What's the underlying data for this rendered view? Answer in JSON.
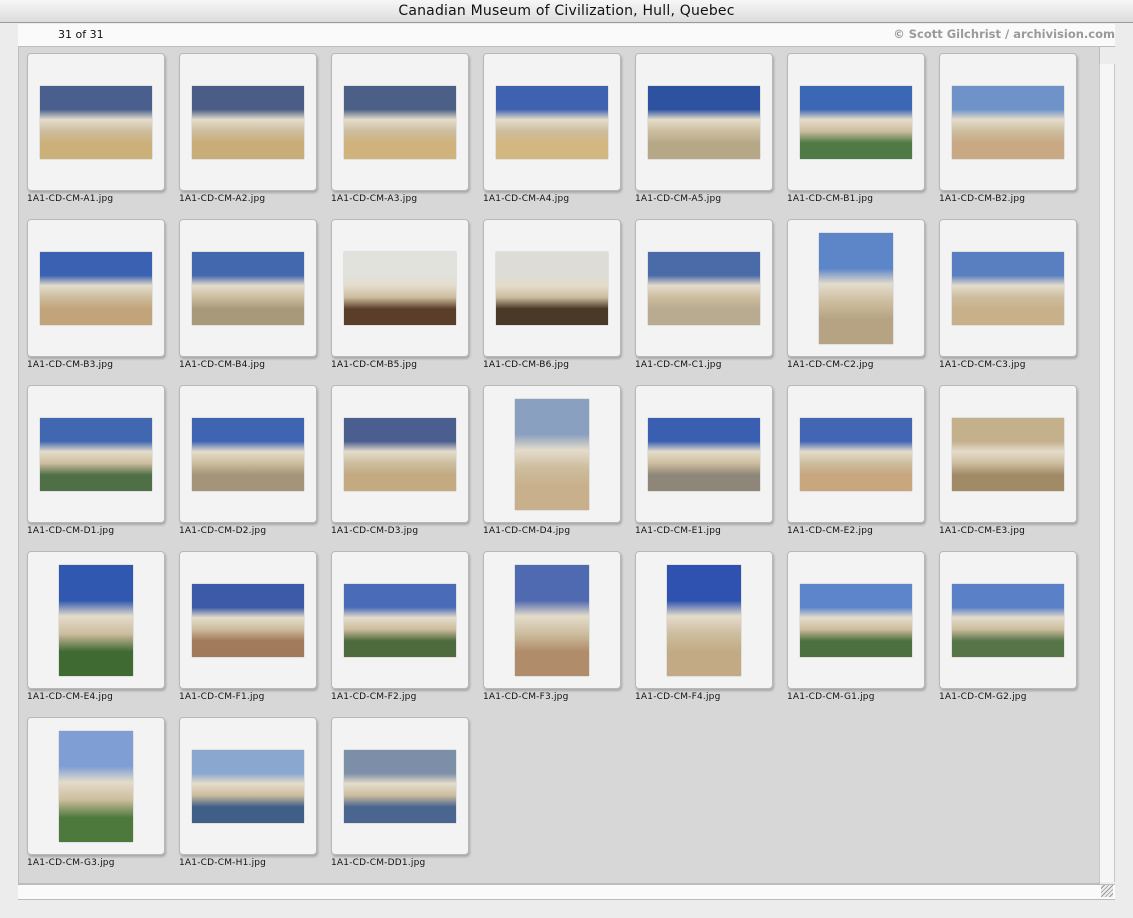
{
  "window": {
    "title": "Canadian Museum of Civilization, Hull, Quebec"
  },
  "info": {
    "count": "31 of 31",
    "credit": "© Scott Gilchrist / archivision.com"
  },
  "icons": {
    "resize": "resize-grip-icon"
  },
  "thumbnails": [
    {
      "name": "1A1-CD-CM-A1.jpg",
      "orientation": "landscape",
      "sky": "#4a5f8e",
      "ground": "#cbb07a"
    },
    {
      "name": "1A1-CD-CM-A2.jpg",
      "orientation": "landscape",
      "sky": "#4b5c86",
      "ground": "#c9ad78"
    },
    {
      "name": "1A1-CD-CM-A3.jpg",
      "orientation": "landscape",
      "sky": "#4c5f86",
      "ground": "#cfb27c"
    },
    {
      "name": "1A1-CD-CM-A4.jpg",
      "orientation": "landscape",
      "sky": "#3f62b0",
      "ground": "#d2b781"
    },
    {
      "name": "1A1-CD-CM-A5.jpg",
      "orientation": "landscape",
      "sky": "#2c52a0",
      "ground": "#b6a887"
    },
    {
      "name": "1A1-CD-CM-B1.jpg",
      "orientation": "landscape",
      "sky": "#3c67b4",
      "ground": "#4f7a45"
    },
    {
      "name": "1A1-CD-CM-B2.jpg",
      "orientation": "landscape",
      "sky": "#6f93c8",
      "ground": "#c8a983"
    },
    {
      "name": "1A1-CD-CM-B3.jpg",
      "orientation": "landscape",
      "sky": "#3a61b2",
      "ground": "#c2a47a"
    },
    {
      "name": "1A1-CD-CM-B4.jpg",
      "orientation": "landscape",
      "sky": "#4468ad",
      "ground": "#a8997a"
    },
    {
      "name": "1A1-CD-CM-B5.jpg",
      "orientation": "landscape",
      "sky": "#e2e2dc",
      "ground": "#5a3e2a"
    },
    {
      "name": "1A1-CD-CM-B6.jpg",
      "orientation": "landscape",
      "sky": "#dedcd6",
      "ground": "#4a3828"
    },
    {
      "name": "1A1-CD-CM-C1.jpg",
      "orientation": "landscape",
      "sky": "#4b6aa8",
      "ground": "#b9ab8f"
    },
    {
      "name": "1A1-CD-CM-C2.jpg",
      "orientation": "portrait",
      "sky": "#5c86c8",
      "ground": "#b5a383"
    },
    {
      "name": "1A1-CD-CM-C3.jpg",
      "orientation": "landscape",
      "sky": "#5a7fc0",
      "ground": "#c7b08a"
    },
    {
      "name": "1A1-CD-CM-D1.jpg",
      "orientation": "landscape",
      "sky": "#4067b0",
      "ground": "#4f7046"
    },
    {
      "name": "1A1-CD-CM-D2.jpg",
      "orientation": "landscape",
      "sky": "#3f65b2",
      "ground": "#a3947a"
    },
    {
      "name": "1A1-CD-CM-D3.jpg",
      "orientation": "landscape",
      "sky": "#4a5e8f",
      "ground": "#c4aa80"
    },
    {
      "name": "1A1-CD-CM-D4.jpg",
      "orientation": "portrait",
      "sky": "#8aa0c0",
      "ground": "#c8b08c"
    },
    {
      "name": "1A1-CD-CM-E1.jpg",
      "orientation": "landscape",
      "sky": "#3a5fb0",
      "ground": "#8e8678"
    },
    {
      "name": "1A1-CD-CM-E2.jpg",
      "orientation": "landscape",
      "sky": "#4265b4",
      "ground": "#c8a67e"
    },
    {
      "name": "1A1-CD-CM-E3.jpg",
      "orientation": "landscape",
      "sky": "#c5b08c",
      "ground": "#a18a66"
    },
    {
      "name": "1A1-CD-CM-E4.jpg",
      "orientation": "portrait",
      "sky": "#3158b0",
      "ground": "#3f6a32"
    },
    {
      "name": "1A1-CD-CM-F1.jpg",
      "orientation": "landscape",
      "sky": "#3c5aa8",
      "ground": "#a07a5a"
    },
    {
      "name": "1A1-CD-CM-F2.jpg",
      "orientation": "landscape",
      "sky": "#4a6cb8",
      "ground": "#4d6b3c"
    },
    {
      "name": "1A1-CD-CM-F3.jpg",
      "orientation": "portrait",
      "sky": "#4f6ab0",
      "ground": "#b08c6a"
    },
    {
      "name": "1A1-CD-CM-F4.jpg",
      "orientation": "portrait",
      "sky": "#2f52b0",
      "ground": "#c2aa84"
    },
    {
      "name": "1A1-CD-CM-G1.jpg",
      "orientation": "landscape",
      "sky": "#5d85cc",
      "ground": "#4d7040"
    },
    {
      "name": "1A1-CD-CM-G2.jpg",
      "orientation": "landscape",
      "sky": "#5a80c8",
      "ground": "#567448"
    },
    {
      "name": "1A1-CD-CM-G3.jpg",
      "orientation": "portrait",
      "sky": "#7f9fd4",
      "ground": "#4d7a3c"
    },
    {
      "name": "1A1-CD-CM-H1.jpg",
      "orientation": "landscape",
      "sky": "#8aa7d0",
      "ground": "#3f5e88"
    },
    {
      "name": "1A1-CD-CM-DD1.jpg",
      "orientation": "landscape",
      "sky": "#7d8fa8",
      "ground": "#4a6590"
    }
  ]
}
